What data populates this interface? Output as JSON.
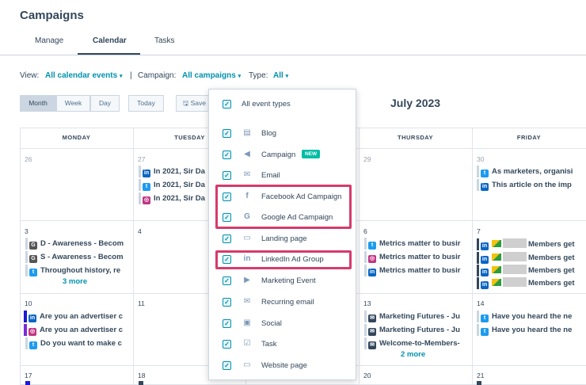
{
  "page": {
    "title": "Campaigns"
  },
  "tabs": [
    {
      "label": "Manage"
    },
    {
      "label": "Calendar"
    },
    {
      "label": "Tasks"
    }
  ],
  "filters": {
    "view_label": "View:",
    "view_value": "All calendar events",
    "sep": "|",
    "campaign_label": "Campaign:",
    "campaign_value": "All campaigns",
    "type_label": "Type:",
    "type_value": "All"
  },
  "toolbar": {
    "month": "Month",
    "week": "Week",
    "day": "Day",
    "today": "Today",
    "save": "Save"
  },
  "calendar": {
    "month_title": "July 2023",
    "days": [
      "MONDAY",
      "TUESDAY",
      "THURSDAY",
      "FRIDAY"
    ],
    "dates": {
      "d26": "26",
      "d27": "27",
      "d29": "29",
      "d30": "30",
      "d3": "3",
      "d4": "4",
      "d6": "6",
      "d7": "7",
      "d10": "10",
      "d11": "11",
      "d13": "13",
      "d14": "14",
      "d17": "17",
      "d18": "18",
      "d20": "20",
      "d21": "21"
    },
    "events": {
      "tue27_1": "In 2021, Sir Da",
      "tue27_2": "In 2021, Sir Da",
      "tue27_3": "In 2021, Sir Da",
      "fri30_1": "As marketers, organisi",
      "fri30_2": "This article on the imp",
      "mon3_1": "D - Awareness - Becom",
      "mon3_2": "S - Awareness - Becom",
      "mon3_3": "Throughout history, re",
      "mon3_more": "3 more",
      "thu6_1": "Metrics matter to busir",
      "thu6_2": "Metrics matter to busir",
      "thu6_3": "Metrics matter to busir",
      "fri7_1": "Members get",
      "fri7_2": "Members get",
      "fri7_3": "Members get",
      "fri7_4": "Members get",
      "mon10_1": "Are you an advertiser c",
      "mon10_2": "Are you an advertiser c",
      "mon10_3": "Do you want to make c",
      "thu13_1": "Marketing Futures - Ju",
      "thu13_2": "Marketing Futures - Ju",
      "thu13_3": "Welcome-to-Members-",
      "thu13_more": "2 more",
      "fri14_1": "Have you heard the ne",
      "fri14_2": "Have you heard the ne"
    }
  },
  "dropdown": {
    "all": "All event types",
    "options": [
      {
        "label": "Blog",
        "icon": "blog-icon"
      },
      {
        "label": "Campaign",
        "icon": "megaphone-icon",
        "badge": "NEW"
      },
      {
        "label": "Email",
        "icon": "envelope-icon"
      },
      {
        "label": "Facebook Ad Campaign",
        "icon": "facebook-icon"
      },
      {
        "label": "Google Ad Campaign",
        "icon": "google-icon"
      },
      {
        "label": "Landing page",
        "icon": "browser-icon"
      },
      {
        "label": "LinkedIn Ad Group",
        "icon": "linkedin-icon"
      },
      {
        "label": "Marketing Event",
        "icon": "video-icon"
      },
      {
        "label": "Recurring email",
        "icon": "envelope-icon"
      },
      {
        "label": "Social",
        "icon": "comment-icon"
      },
      {
        "label": "Task",
        "icon": "task-icon"
      },
      {
        "label": "Website page",
        "icon": "browser-icon"
      }
    ]
  },
  "colors": {
    "accent": "#0091ae",
    "highlight": "#d63b6b",
    "text": "#33475b"
  }
}
